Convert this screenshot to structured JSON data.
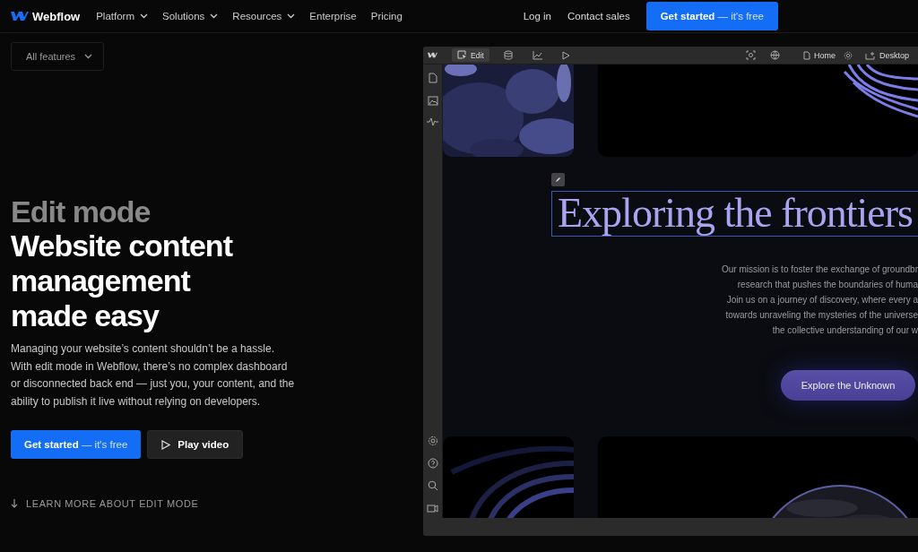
{
  "nav": {
    "logo": "Webflow",
    "items": [
      {
        "label": "Platform",
        "dropdown": true
      },
      {
        "label": "Solutions",
        "dropdown": true
      },
      {
        "label": "Resources",
        "dropdown": true
      },
      {
        "label": "Enterprise",
        "dropdown": false
      },
      {
        "label": "Pricing",
        "dropdown": false
      }
    ],
    "links": [
      "Log in",
      "Contact sales"
    ],
    "cta": "**Get started** — it's free"
  },
  "filter": {
    "label": "All features"
  },
  "hero": {
    "eyebrow": "Edit mode",
    "title": "Website content management made easy",
    "body": "Managing your website’s content shouldn’t be a hassle. With edit mode in Webflow, there’s no complex dashboard or disconnected back end — just you, your content, and the ability to publish it live without relying on developers.",
    "primary": "**Get started** — it's free",
    "secondary": "Play video",
    "learn_more": "LEARN MORE ABOUT EDIT MODE"
  },
  "editor": {
    "modes": [
      {
        "kind": "edit",
        "label": "Edit",
        "selected": true
      },
      {
        "kind": "cms",
        "selected": false
      },
      {
        "kind": "analytics",
        "selected": false
      },
      {
        "kind": "preview",
        "selected": false
      }
    ],
    "page": "Home",
    "breakpoint": "Desktop",
    "canvas": {
      "heading": "Exploring the frontiers",
      "mission": [
        "Our mission is to foster the exchange of groundbr",
        "research that pushes the boundaries of huma",
        "Join us on a journey of discovery, where every a",
        "towards unraveling the mysteries of the universe",
        "the collective understanding of our w"
      ],
      "button": "Explore the Unknown"
    }
  }
}
